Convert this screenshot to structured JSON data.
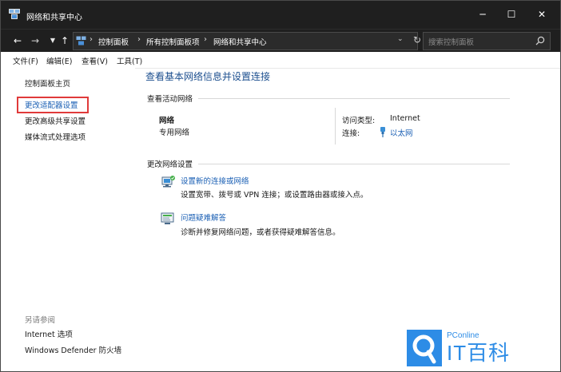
{
  "window": {
    "title": "网络和共享中心",
    "controls": {
      "minimize": "─",
      "maximize": "☐",
      "close": "✕"
    }
  },
  "nav": {
    "back": "←",
    "forward": "→",
    "history": "▼",
    "up": "↑",
    "breadcrumbs": [
      "控制面板",
      "所有控制面板项",
      "网络和共享中心"
    ],
    "breadcrumb_separator": "›",
    "dropdown": "⌄",
    "refresh": "↻",
    "search_placeholder": "搜索控制面板"
  },
  "menu": [
    "文件(F)",
    "编辑(E)",
    "查看(V)",
    "工具(T)"
  ],
  "sidebar": {
    "items": [
      {
        "label": "控制面板主页",
        "link": false
      },
      {
        "label": "更改适配器设置",
        "link": true,
        "highlighted": true
      },
      {
        "label": "更改高级共享设置",
        "link": false
      },
      {
        "label": "媒体流式处理选项",
        "link": false
      }
    ],
    "see_also_label": "另请参阅",
    "see_also": [
      "Internet 选项",
      "Windows Defender 防火墙"
    ]
  },
  "main": {
    "title": "查看基本网络信息并设置连接",
    "active_networks_label": "查看活动网络",
    "network": {
      "name": "网络",
      "type": "专用网络",
      "access_type_label": "访问类型:",
      "access_type_value": "Internet",
      "connections_label": "连接:",
      "connection_value": "以太网"
    },
    "change_settings_label": "更改网络设置",
    "tasks": [
      {
        "title": "设置新的连接或网络",
        "desc": "设置宽带、拨号或 VPN 连接；或设置路由器或接入点。",
        "icon": "network-setup-icon"
      },
      {
        "title": "问题疑难解答",
        "desc": "诊断并修复网络问题，或者获得疑难解答信息。",
        "icon": "troubleshoot-icon"
      }
    ]
  },
  "watermark": {
    "small": "PConline",
    "big": "IT百科"
  },
  "colors": {
    "titlebar": "#1f1f1f",
    "link": "#1a5fb4",
    "heading": "#1c4f8f",
    "highlight_border": "#e03a3a",
    "watermark": "#2d8ce6"
  }
}
